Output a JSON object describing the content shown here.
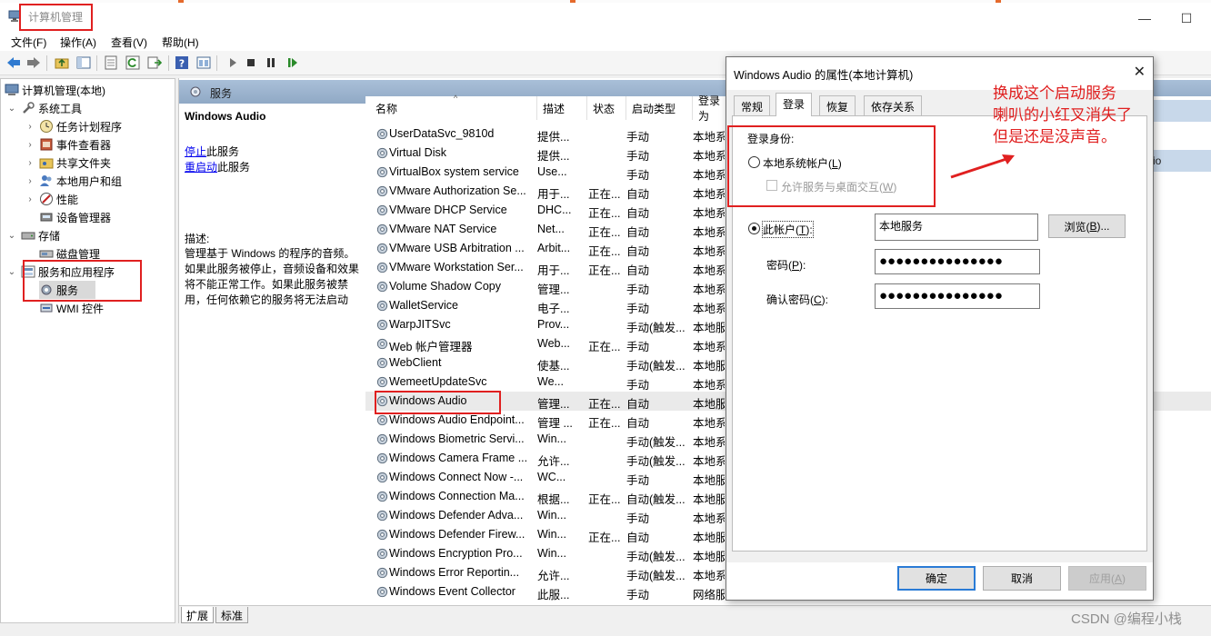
{
  "window": {
    "title": "计算机管理",
    "controls": {
      "minimize": "—",
      "maximize": "☐"
    }
  },
  "menu": [
    "文件(F)",
    "操作(A)",
    "查看(V)",
    "帮助(H)"
  ],
  "tree": {
    "root": "计算机管理(本地)",
    "system_tools": "系统工具",
    "items": [
      "任务计划程序",
      "事件查看器",
      "共享文件夹",
      "本地用户和组",
      "性能",
      "设备管理器"
    ],
    "storage": "存储",
    "disk": "磁盘管理",
    "svc_apps": "服务和应用程序",
    "services": "服务",
    "wmi": "WMI 控件"
  },
  "pane": {
    "header": "服务",
    "selected_name": "Windows Audio",
    "stop_link": "停止",
    "stop_rest": "此服务",
    "restart_link": "重启动",
    "restart_rest": "此服务",
    "desc_label": "描述:",
    "desc_text": "管理基于 Windows 的程序的音频。如果此服务被停止，音频设备和效果将不能正常工作。如果此服务被禁用，任何依赖它的服务将无法启动"
  },
  "columns": [
    "名称",
    "描述",
    "状态",
    "启动类型",
    "登录为"
  ],
  "services": [
    {
      "name": "UserDataSvc_9810d",
      "desc": "提供...",
      "status": "",
      "startup": "手动",
      "logon": "本地系"
    },
    {
      "name": "Virtual Disk",
      "desc": "提供...",
      "status": "",
      "startup": "手动",
      "logon": "本地系"
    },
    {
      "name": "VirtualBox system service",
      "desc": "Use...",
      "status": "",
      "startup": "手动",
      "logon": "本地系"
    },
    {
      "name": "VMware Authorization Se...",
      "desc": "用于...",
      "status": "正在...",
      "startup": "自动",
      "logon": "本地系"
    },
    {
      "name": "VMware DHCP Service",
      "desc": "DHC...",
      "status": "正在...",
      "startup": "自动",
      "logon": "本地系"
    },
    {
      "name": "VMware NAT Service",
      "desc": "Net...",
      "status": "正在...",
      "startup": "自动",
      "logon": "本地系"
    },
    {
      "name": "VMware USB Arbitration ...",
      "desc": "Arbit...",
      "status": "正在...",
      "startup": "自动",
      "logon": "本地系"
    },
    {
      "name": "VMware Workstation Ser...",
      "desc": "用于...",
      "status": "正在...",
      "startup": "自动",
      "logon": "本地系"
    },
    {
      "name": "Volume Shadow Copy",
      "desc": "管理...",
      "status": "",
      "startup": "手动",
      "logon": "本地系"
    },
    {
      "name": "WalletService",
      "desc": "电子...",
      "status": "",
      "startup": "手动",
      "logon": "本地系"
    },
    {
      "name": "WarpJITSvc",
      "desc": "Prov...",
      "status": "",
      "startup": "手动(触发...",
      "logon": "本地服"
    },
    {
      "name": "Web 帐户管理器",
      "desc": "Web...",
      "status": "正在...",
      "startup": "手动",
      "logon": "本地系"
    },
    {
      "name": "WebClient",
      "desc": "使基...",
      "status": "",
      "startup": "手动(触发...",
      "logon": "本地服"
    },
    {
      "name": "WemeetUpdateSvc",
      "desc": "We...",
      "status": "",
      "startup": "手动",
      "logon": "本地系"
    },
    {
      "name": "Windows Audio",
      "desc": "管理...",
      "status": "正在...",
      "startup": "自动",
      "logon": "本地服"
    },
    {
      "name": "Windows Audio Endpoint...",
      "desc": "管理 ...",
      "status": "正在...",
      "startup": "自动",
      "logon": "本地系"
    },
    {
      "name": "Windows Biometric Servi...",
      "desc": "Win...",
      "status": "",
      "startup": "手动(触发...",
      "logon": "本地系"
    },
    {
      "name": "Windows Camera Frame ...",
      "desc": "允许...",
      "status": "",
      "startup": "手动(触发...",
      "logon": "本地系"
    },
    {
      "name": "Windows Connect Now -...",
      "desc": "WC...",
      "status": "",
      "startup": "手动",
      "logon": "本地服"
    },
    {
      "name": "Windows Connection Ma...",
      "desc": "根据...",
      "status": "正在...",
      "startup": "自动(触发...",
      "logon": "本地服"
    },
    {
      "name": "Windows Defender Adva...",
      "desc": "Win...",
      "status": "",
      "startup": "手动",
      "logon": "本地系"
    },
    {
      "name": "Windows Defender Firew...",
      "desc": "Win...",
      "status": "正在...",
      "startup": "自动",
      "logon": "本地服"
    },
    {
      "name": "Windows Encryption Pro...",
      "desc": "Win...",
      "status": "",
      "startup": "手动(触发...",
      "logon": "本地服"
    },
    {
      "name": "Windows Error Reportin...",
      "desc": "允许...",
      "status": "",
      "startup": "手动(触发...",
      "logon": "本地系"
    },
    {
      "name": "Windows Event Collector",
      "desc": "此服...",
      "status": "",
      "startup": "手动",
      "logon": "网络服"
    }
  ],
  "bottom_tabs": [
    "扩展",
    "标准"
  ],
  "right_partial": "io",
  "dialog": {
    "title": "Windows Audio 的属性(本地计算机)",
    "close": "✕",
    "tabs": [
      "常规",
      "登录",
      "恢复",
      "依存关系"
    ],
    "logon_as": "登录身份:",
    "local_system": "本地系统帐户(",
    "local_system_key": "L",
    "allow_desktop": "允许服务与桌面交互(",
    "allow_desktop_key": "W",
    "this_account": "此帐户(",
    "this_account_key": "T",
    "account_value": "本地服务",
    "browse": "浏览(",
    "browse_key": "B",
    "browse_end": ")...",
    "password": "密码(",
    "password_key": "P",
    "confirm": "确认密码(",
    "confirm_key": "C",
    "password_mask": "●●●●●●●●●●●●●●●",
    "ok": "确定",
    "cancel": "取消",
    "apply": "应用(",
    "apply_key": "A"
  },
  "annotation": [
    "换成这个启动服务",
    "喇叭的小红叉消失了",
    "但是还是没声音。"
  ],
  "watermark": "CSDN @编程小栈",
  "colors": {
    "annotation_red": "#e02020",
    "link_blue": "#0000ee",
    "header_blue": "#9bb3cf"
  }
}
